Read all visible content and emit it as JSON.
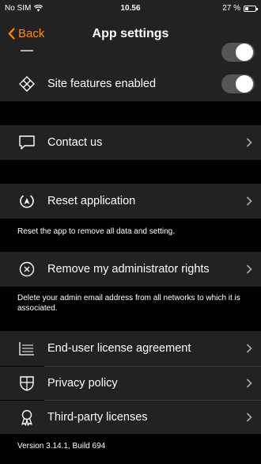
{
  "status_bar": {
    "carrier": "No SIM",
    "time": "10.56",
    "battery_text": "27 %",
    "battery_level": 0.27
  },
  "nav": {
    "back_label": "Back",
    "title": "App settings"
  },
  "settings": {
    "site_features_label": "Site features enabled",
    "contact_label": "Contact us",
    "reset_label": "Reset application",
    "reset_note": "Reset the app to remove all data and setting.",
    "remove_admin_label": "Remove my administrator rights",
    "remove_admin_note": "Delete your admin email address from all networks to which it is associated.",
    "eula_label": "End-user license agreement",
    "privacy_label": "Privacy policy",
    "third_party_label": "Third-party licenses",
    "version": "Version 3.14.1, Build 694"
  },
  "colors": {
    "accent": "#ff8a00",
    "row_background": "#222222",
    "page_background": "#000000"
  }
}
